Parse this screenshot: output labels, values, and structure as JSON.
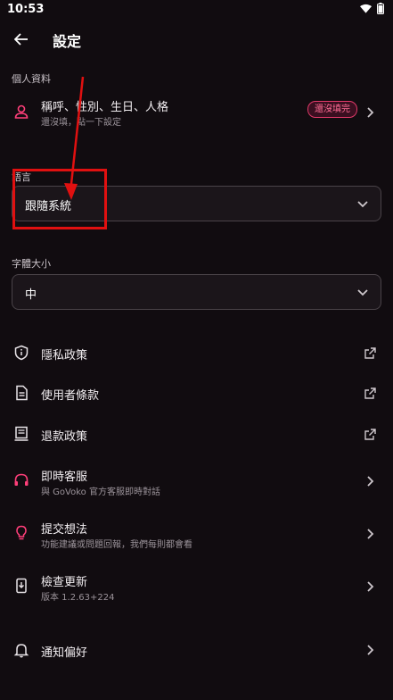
{
  "status": {
    "time": "10:53"
  },
  "header": {
    "title": "設定"
  },
  "profile": {
    "section_label": "個人資料",
    "title": "稱呼、性別、生日、人格",
    "subtitle": "還沒填，點一下設定",
    "badge": "還沒填完"
  },
  "language": {
    "section_label": "語言",
    "value": "跟隨系統"
  },
  "font_size": {
    "section_label": "字體大小",
    "value": "中"
  },
  "menu": {
    "privacy": {
      "title": "隱私政策"
    },
    "terms": {
      "title": "使用者條款"
    },
    "refund": {
      "title": "退款政策"
    },
    "support": {
      "title": "即時客服",
      "subtitle": "與 GoVoko 官方客服即時對話"
    },
    "feedback": {
      "title": "提交想法",
      "subtitle": "功能建議或問題回報，我們每則都會看"
    },
    "update": {
      "title": "檢查更新",
      "subtitle": "版本 1.2.63+224"
    },
    "notifications": {
      "title": "通知偏好"
    }
  },
  "colors": {
    "background": "#110c10",
    "accent": "#ff3f7a",
    "annotation": "#e01010"
  }
}
